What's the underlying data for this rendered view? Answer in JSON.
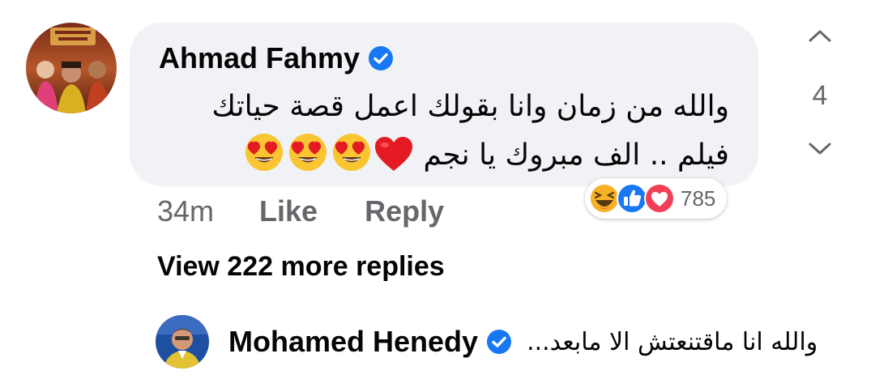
{
  "comment": {
    "author": "Ahmad Fahmy",
    "verified": true,
    "text_line1": "والله من زمان وانا بقولك اعمل قصة حياتك",
    "text_line2": "فيلم .. الف مبروك يا نجم",
    "emojis": [
      "heart-emoji",
      "heart-eyes-emoji",
      "heart-eyes-emoji",
      "heart-eyes-emoji"
    ],
    "time": "34m",
    "like_label": "Like",
    "reply_label": "Reply",
    "reaction_count": "785",
    "reaction_icons": [
      "haha-icon",
      "like-icon",
      "love-icon"
    ],
    "vote_count": "4"
  },
  "replies": {
    "view_more_label": "View 222 more replies",
    "latest": {
      "author": "Mohamed Henedy",
      "verified": true,
      "snippet": "والله انا ماقتنعتش الا مابعد..."
    }
  },
  "colors": {
    "bubble": "#f0f2f5",
    "meta_text": "#65676b",
    "verified_blue": "#1877f2",
    "like_blue": "#1877f2",
    "love_red": "#f33e58",
    "haha_yellow": "#f7b125"
  }
}
